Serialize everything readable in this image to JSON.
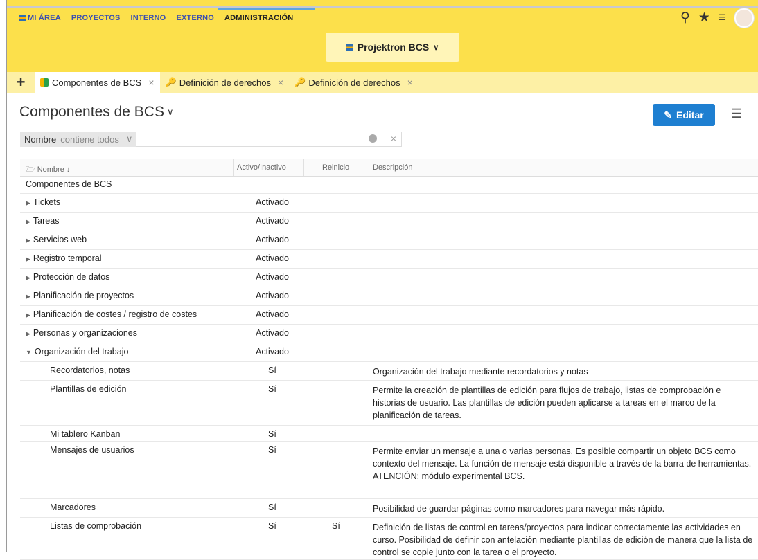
{
  "nav": {
    "items": [
      {
        "label": "MI ÁREA"
      },
      {
        "label": "PROYECTOS"
      },
      {
        "label": "INTERNO"
      },
      {
        "label": "EXTERNO"
      },
      {
        "label": "ADMINISTRACIÓN"
      }
    ],
    "active_index": 4
  },
  "brand": {
    "label": "Projektron BCS"
  },
  "tabs": [
    {
      "label": "Componentes de BCS",
      "icon": "components-icon",
      "active": true
    },
    {
      "label": "Definición de derechos",
      "icon": "key-icon",
      "active": false
    },
    {
      "label": "Definición de derechos",
      "icon": "key-icon",
      "active": false
    }
  ],
  "page": {
    "title": "Componentes de BCS",
    "edit_label": "Editar"
  },
  "filter": {
    "field": "Nombre",
    "operator": "contiene todos",
    "value": ""
  },
  "table": {
    "columns": [
      "Nombre",
      "Activo/Inactivo",
      "Reinicio",
      "Descripción"
    ],
    "root": "Componentes de BCS",
    "rows": [
      {
        "name": "Tickets",
        "status": "Activado",
        "restart": "",
        "desc": "",
        "level": 0,
        "expanded": false
      },
      {
        "name": "Tareas",
        "status": "Activado",
        "restart": "",
        "desc": "",
        "level": 0,
        "expanded": false
      },
      {
        "name": "Servicios web",
        "status": "Activado",
        "restart": "",
        "desc": "",
        "level": 0,
        "expanded": false
      },
      {
        "name": "Registro temporal",
        "status": "Activado",
        "restart": "",
        "desc": "",
        "level": 0,
        "expanded": false
      },
      {
        "name": "Protección de datos",
        "status": "Activado",
        "restart": "",
        "desc": "",
        "level": 0,
        "expanded": false
      },
      {
        "name": "Planificación de proyectos",
        "status": "Activado",
        "restart": "",
        "desc": "",
        "level": 0,
        "expanded": false
      },
      {
        "name": "Planificación de costes / registro de costes",
        "status": "Activado",
        "restart": "",
        "desc": "",
        "level": 0,
        "expanded": false
      },
      {
        "name": "Personas y organizaciones",
        "status": "Activado",
        "restart": "",
        "desc": "",
        "level": 0,
        "expanded": false
      },
      {
        "name": "Organización del trabajo",
        "status": "Activado",
        "restart": "",
        "desc": "",
        "level": 0,
        "expanded": true
      },
      {
        "name": "Recordatorios, notas",
        "status": "Sí",
        "restart": "",
        "desc": "Organización del trabajo mediante recordatorios y notas",
        "level": 1
      },
      {
        "name": "Plantillas de edición",
        "status": "Sí",
        "restart": "",
        "desc": "Permite la creación de plantillas de edición para flujos de trabajo, listas de comprobación e historias de usuario. Las plantillas de edición pueden aplicarse a tareas en el marco de la planificación de tareas.",
        "level": 1
      },
      {
        "name": "Mi tablero Kanban",
        "status": "Sí",
        "restart": "",
        "desc": "",
        "level": 1
      },
      {
        "name": "Mensajes de usuarios",
        "status": "Sí",
        "restart": "",
        "desc": "Permite enviar un mensaje a una o varias personas. Es posible compartir un objeto BCS como contexto del mensaje. La función de mensaje está disponible a través de la barra de herramientas.\nATENCIÓN: módulo experimental BCS.",
        "level": 1
      },
      {
        "name": "Marcadores",
        "status": "Sí",
        "restart": "",
        "desc": "Posibilidad de guardar páginas como marcadores para navegar más rápido.",
        "level": 1
      },
      {
        "name": "Listas de comprobación",
        "status": "Sí",
        "restart": "Sí",
        "desc": "Definición de listas de control en tareas/proyectos para indicar correctamente las actividades en curso. Posibilidad de definir con antelación mediante plantillas de edición de manera que la lista de control se copie junto con la tarea o el proyecto.",
        "level": 1
      }
    ]
  }
}
